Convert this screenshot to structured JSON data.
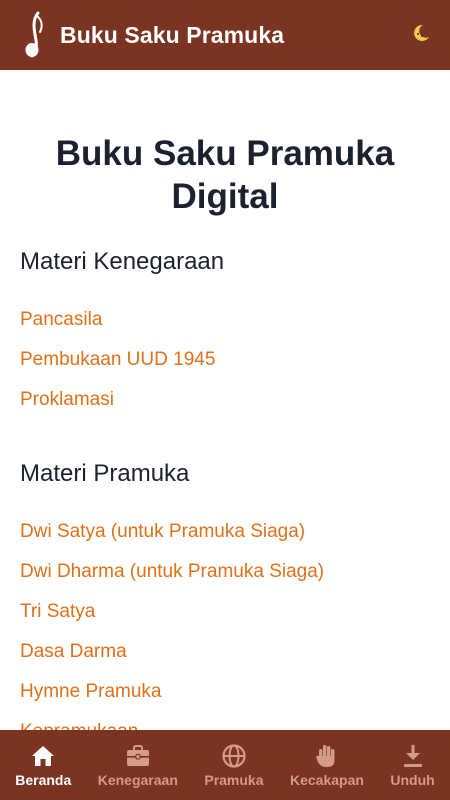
{
  "app": {
    "title": "Buku Saku Pramuka",
    "colors": {
      "bar": "#7b3322",
      "link": "#e0701a",
      "heading": "#1c2130",
      "nav_inactive": "#d49a8a",
      "nav_active": "#ffffff"
    },
    "logo_icon": "tunas-kelapa-icon",
    "theme_toggle_icon": "moon-icon"
  },
  "main": {
    "page_title": "Buku Saku Pramuka Digital",
    "sections": [
      {
        "heading": "Materi Kenegaraan",
        "links": [
          "Pancasila",
          "Pembukaan UUD 1945",
          "Proklamasi"
        ]
      },
      {
        "heading": "Materi Pramuka",
        "links": [
          "Dwi Satya (untuk Pramuka Siaga)",
          "Dwi Dharma (untuk Pramuka Siaga)",
          "Tri Satya",
          "Dasa Darma",
          "Hymne Pramuka",
          "Kepramukaan"
        ]
      }
    ]
  },
  "bottom_nav": {
    "active": "Beranda",
    "items": [
      {
        "label": "Beranda",
        "icon": "home-icon"
      },
      {
        "label": "Kenegaraan",
        "icon": "briefcase-icon"
      },
      {
        "label": "Pramuka",
        "icon": "globe-icon"
      },
      {
        "label": "Kecakapan",
        "icon": "hand-icon"
      },
      {
        "label": "Unduh",
        "icon": "download-icon"
      }
    ]
  }
}
